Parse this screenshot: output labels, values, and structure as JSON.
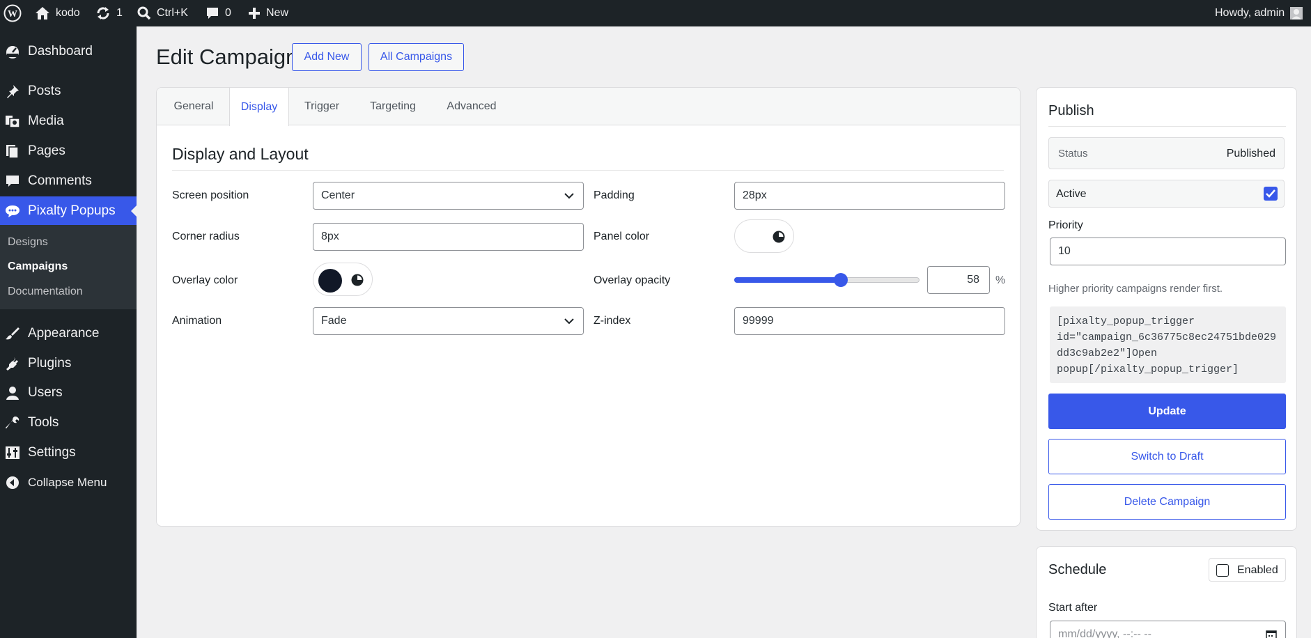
{
  "adminbar": {
    "site_name": "kodo",
    "updates_count": "1",
    "search_label": "Ctrl+K",
    "comments_count": "0",
    "new_label": "New",
    "greeting": "Howdy, admin"
  },
  "sidebar": {
    "items": [
      {
        "label": "Dashboard",
        "icon": "dashboard-icon"
      },
      {
        "label": "Posts",
        "icon": "pin-icon"
      },
      {
        "label": "Media",
        "icon": "media-icon"
      },
      {
        "label": "Pages",
        "icon": "pages-icon"
      },
      {
        "label": "Comments",
        "icon": "comment-icon"
      },
      {
        "label": "Pixalty Popups",
        "icon": "comment-icon"
      },
      {
        "label": "Appearance",
        "icon": "brush-icon"
      },
      {
        "label": "Plugins",
        "icon": "plug-icon"
      },
      {
        "label": "Users",
        "icon": "user-icon"
      },
      {
        "label": "Tools",
        "icon": "wrench-icon"
      },
      {
        "label": "Settings",
        "icon": "settings-icon"
      },
      {
        "label": "Collapse Menu",
        "icon": "collapse-icon"
      }
    ],
    "submenu": [
      "Designs",
      "Campaigns",
      "Documentation"
    ]
  },
  "header": {
    "title": "Edit Campaign",
    "add_new": "Add New",
    "all_campaigns": "All Campaigns"
  },
  "tabs": [
    "General",
    "Display",
    "Trigger",
    "Targeting",
    "Advanced"
  ],
  "display": {
    "section_title": "Display and Layout",
    "screen_position": {
      "label": "Screen position",
      "value": "Center"
    },
    "padding": {
      "label": "Padding",
      "value": "28px"
    },
    "corner_radius": {
      "label": "Corner radius",
      "value": "8px"
    },
    "panel_color": {
      "label": "Panel color",
      "color": "#ffffff"
    },
    "overlay_color": {
      "label": "Overlay color",
      "color": "#111827"
    },
    "overlay_opacity": {
      "label": "Overlay opacity",
      "value": "58",
      "unit": "%",
      "min": 0,
      "max": 100
    },
    "animation": {
      "label": "Animation",
      "value": "Fade"
    },
    "zindex": {
      "label": "Z-index",
      "value": "99999"
    }
  },
  "publish": {
    "title": "Publish",
    "status_label": "Status",
    "status_value": "Published",
    "active_label": "Active",
    "active_checked": true,
    "priority_label": "Priority",
    "priority_value": "10",
    "priority_help": "Higher priority campaigns render first.",
    "shortcode_lines": [
      "[pixalty_popup_trigger",
      "id=\"campaign_6c36775c8ec24751bde029",
      "dd3c9ab2e2\"]Open",
      "popup[/pixalty_popup_trigger]"
    ],
    "update_label": "Update",
    "draft_label": "Switch to Draft",
    "delete_label": "Delete Campaign"
  },
  "schedule": {
    "title": "Schedule",
    "enabled_label": "Enabled",
    "enabled_checked": false,
    "start_label": "Start after",
    "start_placeholder": "mm/dd/yyyy, --:-- --"
  },
  "colors": {
    "accent": "#3858e9",
    "adminbar_bg": "#1d2327"
  }
}
